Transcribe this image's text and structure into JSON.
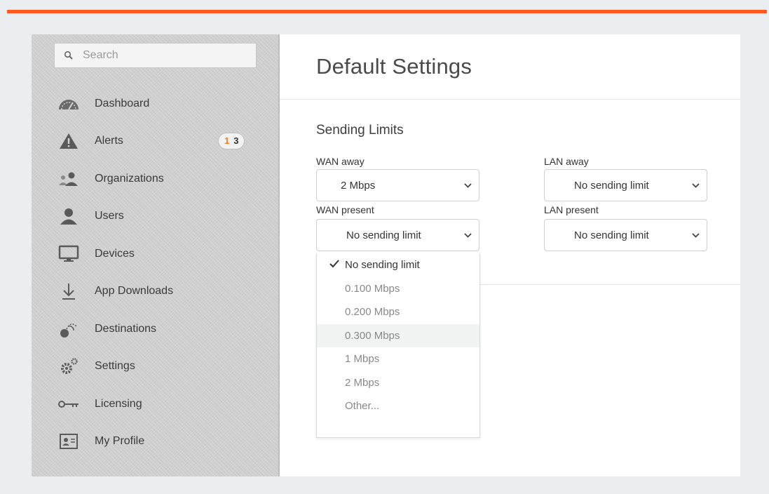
{
  "search": {
    "placeholder": "Search"
  },
  "sidebar": {
    "items": [
      {
        "label": "Dashboard",
        "icon": "dashboard-icon"
      },
      {
        "label": "Alerts",
        "icon": "alert-icon",
        "badge": {
          "first": "1",
          "second": "3"
        }
      },
      {
        "label": "Organizations",
        "icon": "organizations-icon"
      },
      {
        "label": "Users",
        "icon": "user-icon"
      },
      {
        "label": "Devices",
        "icon": "monitor-icon"
      },
      {
        "label": "App Downloads",
        "icon": "download-icon"
      },
      {
        "label": "Destinations",
        "icon": "destinations-icon"
      },
      {
        "label": "Settings",
        "icon": "gears-icon"
      },
      {
        "label": "Licensing",
        "icon": "key-icon"
      },
      {
        "label": "My Profile",
        "icon": "profile-card-icon"
      }
    ]
  },
  "main": {
    "title": "Default Settings",
    "section_title": "Sending Limits",
    "fields": {
      "wan_away": {
        "label": "WAN away",
        "value": "2 Mbps"
      },
      "lan_away": {
        "label": "LAN away",
        "value": "No sending limit"
      },
      "wan_present": {
        "label": "WAN present",
        "value": "No sending limit"
      },
      "lan_present": {
        "label": "LAN present",
        "value": "No sending limit"
      }
    },
    "dropdown": {
      "options": [
        "No sending limit",
        "0.100 Mbps",
        "0.200 Mbps",
        "0.300 Mbps",
        "1 Mbps",
        "2 Mbps",
        "Other..."
      ],
      "selected": "No sending limit",
      "hovered": "0.300 Mbps"
    }
  },
  "colors": {
    "accent": "#ff5a1f",
    "badge_alert": "#ff7a1f",
    "background": "#ebeef1",
    "sidebar": "#d2d2d2"
  }
}
